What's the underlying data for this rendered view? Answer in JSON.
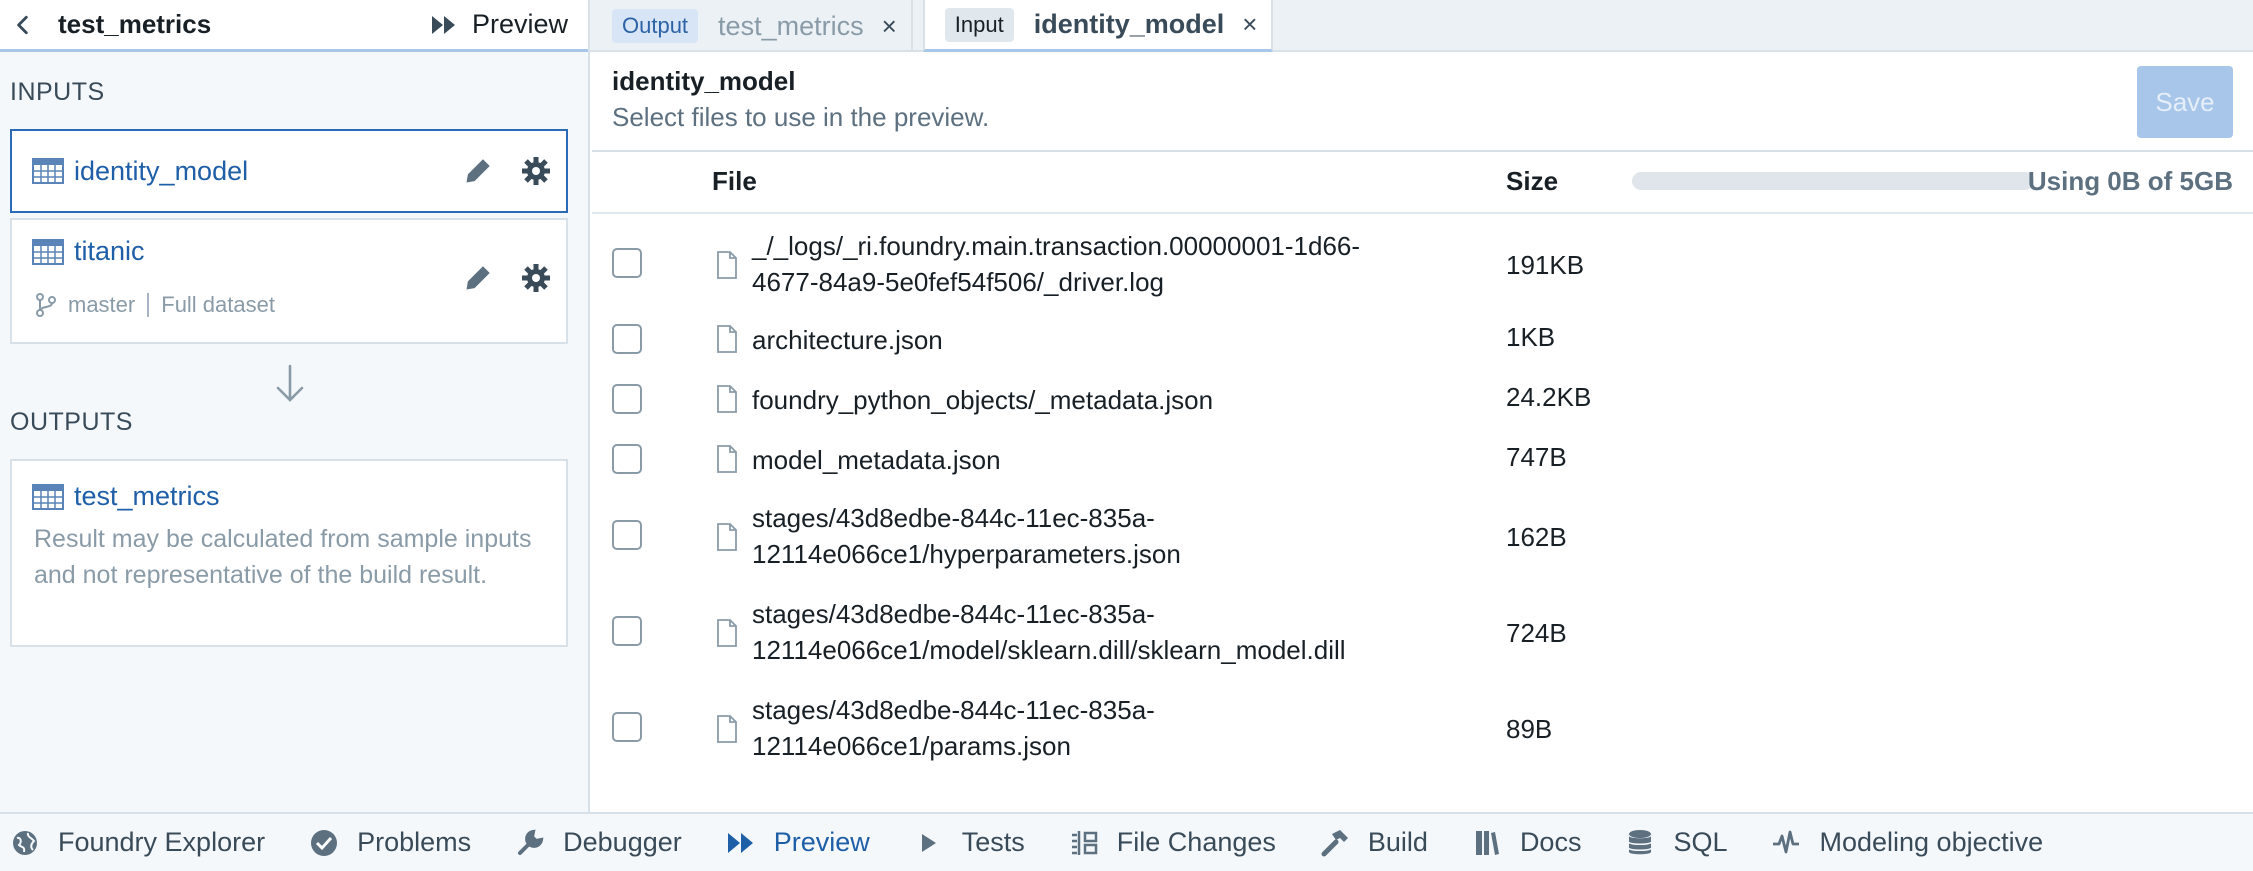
{
  "left_panel": {
    "title": "test_metrics",
    "preview_label": "Preview",
    "inputs_label": "INPUTS",
    "outputs_label": "OUTPUTS",
    "inputs": [
      {
        "name": "identity_model"
      },
      {
        "name": "titanic",
        "branch": "master",
        "mode": "Full dataset"
      }
    ],
    "output": {
      "name": "test_metrics",
      "description": "Result may be calculated from sample inputs and not representative of the build result."
    }
  },
  "tabs": [
    {
      "tag": "Output",
      "name": "test_metrics",
      "close": "×",
      "active": false
    },
    {
      "tag": "Input",
      "name": "identity_model",
      "close": "×",
      "active": true
    }
  ],
  "main": {
    "title": "identity_model",
    "subtitle": "Select files to use in the preview.",
    "save_label": "Save",
    "col_file": "File",
    "col_size": "Size",
    "usage_text": "Using 0B of 5GB",
    "usage_fraction": 0,
    "files": [
      {
        "name": "_/_logs/_ri.foundry.main.transaction.00000001-1d66-4677-84a9-5e0fef54f506/_driver.log",
        "size": "191KB",
        "checked": false
      },
      {
        "name": "architecture.json",
        "size": "1KB",
        "checked": false
      },
      {
        "name": "foundry_python_objects/_metadata.json",
        "size": "24.2KB",
        "checked": false
      },
      {
        "name": "model_metadata.json",
        "size": "747B",
        "checked": false
      },
      {
        "name": "stages/43d8edbe-844c-11ec-835a-12114e066ce1/hyperparameters.json",
        "size": "162B",
        "checked": false
      },
      {
        "name": "stages/43d8edbe-844c-11ec-835a-12114e066ce1/model/sklearn.dill/sklearn_model.dill",
        "size": "724B",
        "checked": false
      },
      {
        "name": "stages/43d8edbe-844c-11ec-835a-12114e066ce1/params.json",
        "size": "89B",
        "checked": false
      }
    ]
  },
  "bottom_bar": [
    {
      "label": "Foundry Explorer",
      "icon": "globe-icon"
    },
    {
      "label": "Problems",
      "icon": "check-circle-icon"
    },
    {
      "label": "Debugger",
      "icon": "wrench-icon"
    },
    {
      "label": "Preview",
      "icon": "fast-forward-icon",
      "active": true
    },
    {
      "label": "Tests",
      "icon": "play-icon"
    },
    {
      "label": "File Changes",
      "icon": "diff-icon"
    },
    {
      "label": "Build",
      "icon": "hammer-icon"
    },
    {
      "label": "Docs",
      "icon": "book-icon"
    },
    {
      "label": "SQL",
      "icon": "database-icon"
    },
    {
      "label": "Modeling objective",
      "icon": "pulse-icon"
    }
  ],
  "colors": {
    "accent": "#1f5fa8",
    "save_disabled": "#a7c6ea",
    "output_tag_bg": "#d7e5f6"
  }
}
